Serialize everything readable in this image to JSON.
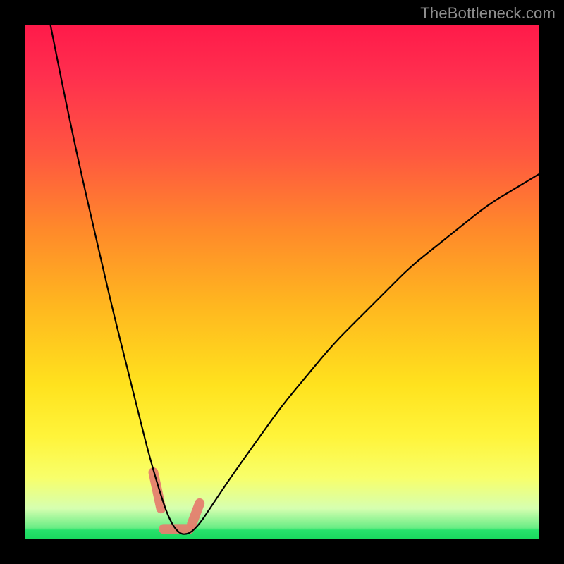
{
  "watermark": "TheBottleneck.com",
  "chart_data": {
    "type": "line",
    "title": "",
    "xlabel": "",
    "ylabel": "",
    "xlim": [
      0,
      100
    ],
    "ylim": [
      0,
      100
    ],
    "grid": false,
    "legend": false,
    "background": "gradient-green-to-red",
    "notes": "Black V-shaped curve over a vertical green-yellow-red gradient. Valley bottom is near-zero around x≈27–32. Left branch rises steeply to the top-left; right branch rises more gradually toward the top-right. Short coral dashed segments highlight the valley floor.",
    "series": [
      {
        "name": "curve",
        "x": [
          5,
          8,
          11,
          14,
          17,
          20,
          22,
          24,
          26,
          28,
          30,
          32,
          34,
          36,
          40,
          45,
          50,
          55,
          60,
          65,
          70,
          75,
          80,
          85,
          90,
          95,
          100
        ],
        "values": [
          100,
          85,
          71,
          58,
          45,
          33,
          25,
          17,
          10,
          4,
          1,
          1,
          3,
          6,
          12,
          19,
          26,
          32,
          38,
          43,
          48,
          53,
          57,
          61,
          65,
          68,
          71
        ]
      }
    ],
    "highlight_segments": [
      {
        "x": [
          25,
          26.5
        ],
        "values": [
          13,
          6
        ]
      },
      {
        "x": [
          27,
          32
        ],
        "values": [
          2,
          2
        ]
      },
      {
        "x": [
          32.5,
          34
        ],
        "values": [
          3,
          7
        ]
      }
    ]
  }
}
